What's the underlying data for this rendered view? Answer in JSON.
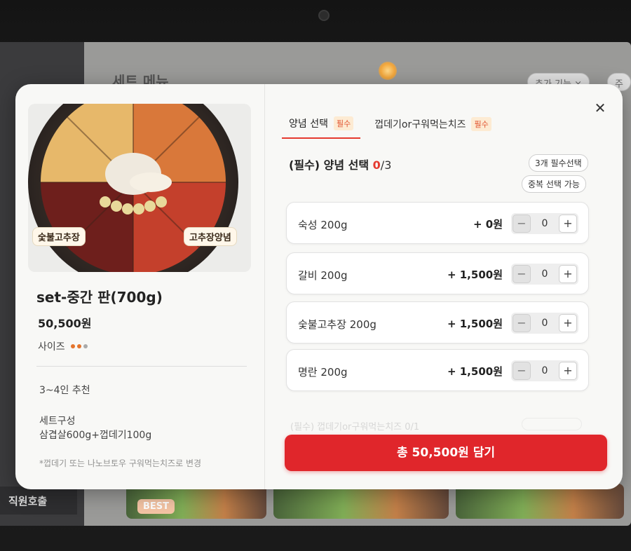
{
  "background": {
    "title": "세트 메뉴",
    "chips": [
      "추가 기능 ×",
      "주"
    ],
    "staff_call": "직원호출",
    "best_badge": "BEST"
  },
  "modal": {
    "close_icon": "close-icon",
    "product": {
      "photo_labels": [
        "숯불고추장",
        "고추장양념"
      ],
      "name": "set-중간 판(700g)",
      "price": "50,500원",
      "size_label": "사이즈",
      "size_dots": [
        "#e4742c",
        "#e4742c",
        "#aaaaaa"
      ],
      "recommend": "3~4인 추천",
      "composition_title": "세트구성",
      "composition": "삼겹살600g+껍데기100g",
      "note": "*껍데기 또는 나노브토우 구워먹는치즈로 변경"
    },
    "tabs": [
      {
        "label": "양념 선택",
        "badge": "필수"
      },
      {
        "label": "껍데기or구워먹는치즈",
        "badge": "필수"
      }
    ],
    "section": {
      "prefix": "(필수) 양념 선택 ",
      "count": "0",
      "total": "/3",
      "chip_required": "3개 필수선택",
      "chip_duplicate": "중복 선택 가능"
    },
    "options": [
      {
        "name": "숙성 200g",
        "price": "+ 0원",
        "qty": "0"
      },
      {
        "name": "갈비 200g",
        "price": "+ 1,500원",
        "qty": "0"
      },
      {
        "name": "숯불고추장 200g",
        "price": "+ 1,500원",
        "qty": "0"
      },
      {
        "name": "명란 200g",
        "price": "+ 1,500원",
        "qty": "0"
      }
    ],
    "next_section_peek": "(필수) 껍데기or구워먹는치즈 0/1",
    "stepper_minus": "−",
    "stepper_plus": "+",
    "add_button": "총 50,500원 담기"
  },
  "colors": {
    "accent_red": "#e0262b",
    "badge_orange": "#e0502c"
  }
}
